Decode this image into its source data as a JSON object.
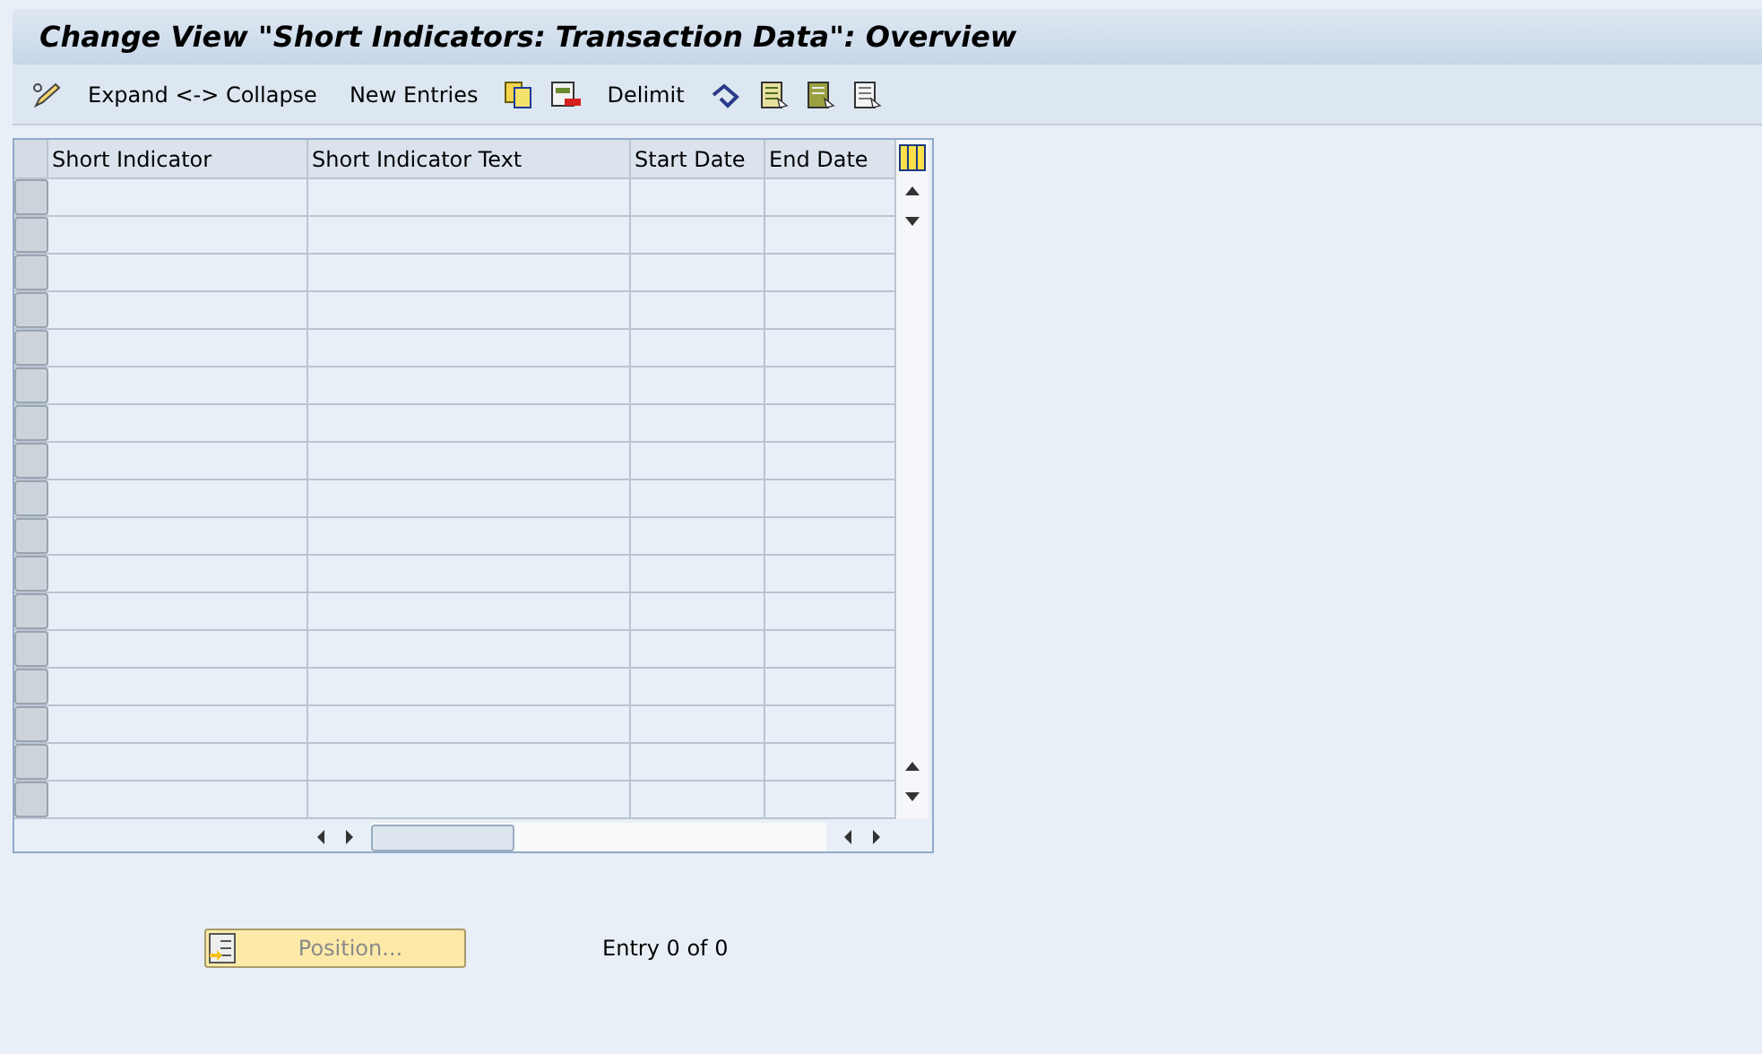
{
  "window": {
    "title": "Change View \"Short Indicators: Transaction Data\": Overview"
  },
  "toolbar": [
    {
      "kind": "icon"
    },
    {
      "kind": "text",
      "label": "Expand <-> Collapse"
    },
    {
      "kind": "text",
      "label": "New Entries"
    },
    {
      "kind": "icon"
    },
    {
      "kind": "icon"
    },
    {
      "kind": "text",
      "label": "Delimit"
    },
    {
      "kind": "icon"
    },
    {
      "kind": "icon"
    },
    {
      "kind": "icon"
    },
    {
      "kind": "icon"
    }
  ],
  "table": {
    "columns": [
      "Short Indicator",
      "Short Indicator Text",
      "Start Date",
      "End Date"
    ]
  },
  "position_button": {
    "label": "Position...",
    "disabled": true
  },
  "entry_info": "Entry 0 of 0"
}
